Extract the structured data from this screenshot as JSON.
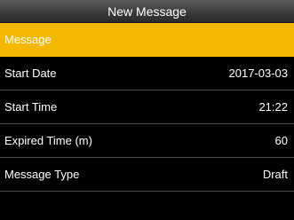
{
  "header": {
    "title": "New Message"
  },
  "menu": {
    "items": [
      {
        "label": "Message",
        "value": ""
      },
      {
        "label": "Start Date",
        "value": "2017-03-03"
      },
      {
        "label": "Start Time",
        "value": "21:22"
      },
      {
        "label": "Expired Time (m)",
        "value": "60"
      },
      {
        "label": "Message Type",
        "value": "Draft"
      }
    ]
  },
  "colors": {
    "selected_row": "#f5b800",
    "background": "#000000",
    "text": "#ffffff"
  }
}
